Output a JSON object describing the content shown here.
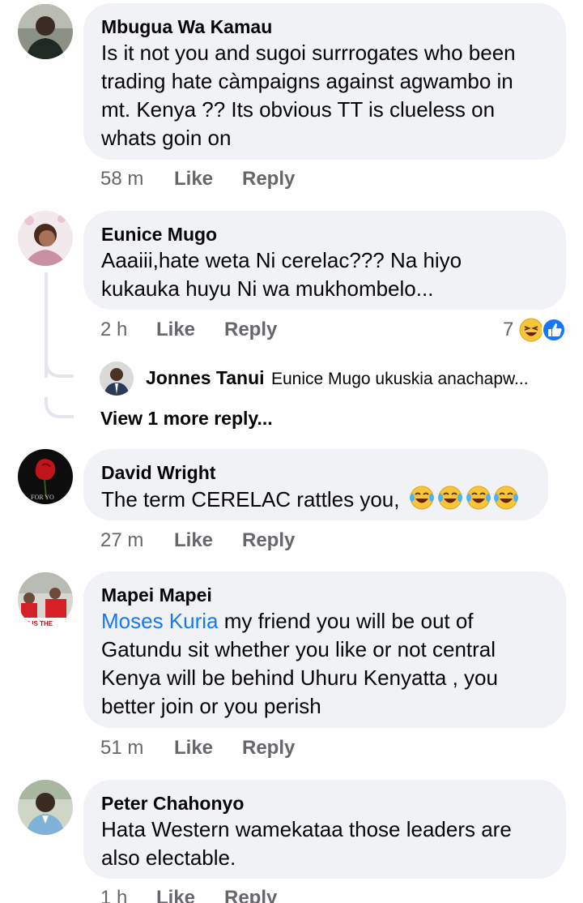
{
  "comments": [
    {
      "author": "Mbugua Wa Kamau",
      "text": "Is it not you and sugoi surrrogates who been\ntrading hate càmpaigns against agwambo in\nmt. Kenya ??  Its obvious TT is clueless on\nwhats goin on",
      "time": "58 m",
      "like_label": "Like",
      "reply_label": "Reply"
    },
    {
      "author": "Eunice Mugo",
      "text": "Aaaiii,hate weta Ni cerelac??? Na hiyo\nkukauka huyu Ni wa mukhombelo...",
      "time": "2 h",
      "like_label": "Like",
      "reply_label": "Reply",
      "reaction_count": "7",
      "reply_preview": {
        "author": "Jonnes Tanui",
        "text": "Eunice Mugo ukuskia anachapw..."
      },
      "view_more_label": "View 1 more reply..."
    },
    {
      "author": "David Wright",
      "text": "The term CERELAC rattles you,",
      "time": "27 m",
      "like_label": "Like",
      "reply_label": "Reply"
    },
    {
      "author": "Mapei Mapei",
      "mention": "Moses Kuria",
      "text": " my friend you will be out of\nGatundu sit whether you like or not central\nKenya will be behind Uhuru Kenyatta , you\nbetter join or you perish",
      "time": "51 m",
      "like_label": "Like",
      "reply_label": "Reply"
    },
    {
      "author": "Peter Chahonyo",
      "text": "Hata Western wamekataa those leaders are\nalso electable.",
      "time": "1 h",
      "like_label": "Like",
      "reply_label": "Reply"
    }
  ],
  "avatar_caption_david": "FOR YO",
  "avatar_caption_mapei": "ER IS THE",
  "colors": {
    "bubble": "#f0f2f5",
    "mention": "#1877f2",
    "meta": "#65676b",
    "like_reaction": "#1877f2",
    "haha_reaction": "#f7c53a"
  }
}
